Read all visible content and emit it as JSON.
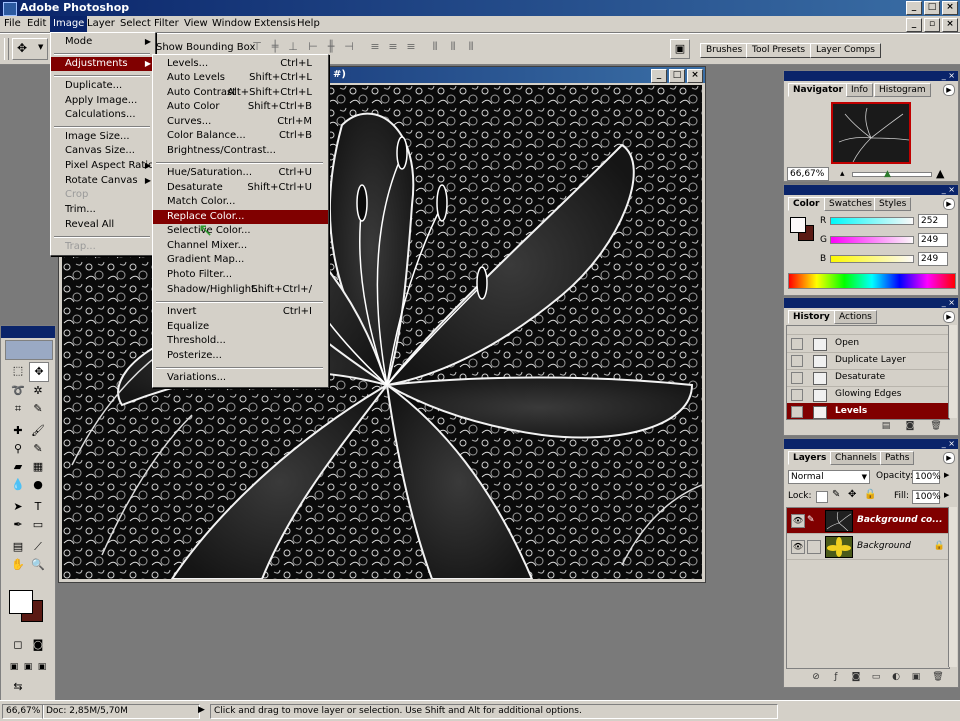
{
  "app": {
    "title": "Adobe Photoshop",
    "window_buttons": [
      "_",
      "□",
      "×"
    ]
  },
  "menubar": [
    "File",
    "Edit",
    "Image",
    "Layer",
    "Select",
    "Filter",
    "View",
    "Window",
    "Extensis",
    "Help"
  ],
  "optionsbar": {
    "show_bounding_box": "Show Bounding Box"
  },
  "palette_well": {
    "brushes": "Brushes",
    "tool_presets": "Tool Presets",
    "layer_comps": "Layer Comps"
  },
  "document": {
    "title_fragment": "#)"
  },
  "image_menu": {
    "items": [
      {
        "label": "Mode",
        "submenu": true
      },
      {
        "label": "Adjustments",
        "submenu": true,
        "highlighted": true
      },
      {
        "label": "Duplicate..."
      },
      {
        "label": "Apply Image..."
      },
      {
        "label": "Calculations..."
      },
      {
        "label": "Image Size..."
      },
      {
        "label": "Canvas Size..."
      },
      {
        "label": "Pixel Aspect Ratio",
        "submenu": true
      },
      {
        "label": "Rotate Canvas",
        "submenu": true
      },
      {
        "label": "Crop",
        "disabled": true
      },
      {
        "label": "Trim..."
      },
      {
        "label": "Reveal All"
      },
      {
        "label": "Trap...",
        "disabled": true
      }
    ]
  },
  "adjustments_menu": {
    "items": [
      {
        "label": "Levels...",
        "shortcut": "Ctrl+L"
      },
      {
        "label": "Auto Levels",
        "shortcut": "Shift+Ctrl+L"
      },
      {
        "label": "Auto Contrast",
        "shortcut": "Alt+Shift+Ctrl+L"
      },
      {
        "label": "Auto Color",
        "shortcut": "Shift+Ctrl+B"
      },
      {
        "label": "Curves...",
        "shortcut": "Ctrl+M"
      },
      {
        "label": "Color Balance...",
        "shortcut": "Ctrl+B"
      },
      {
        "label": "Brightness/Contrast...",
        "shortcut": ""
      },
      {
        "label": "Hue/Saturation...",
        "shortcut": "Ctrl+U"
      },
      {
        "label": "Desaturate",
        "shortcut": "Shift+Ctrl+U"
      },
      {
        "label": "Match Color...",
        "shortcut": ""
      },
      {
        "label": "Replace Color...",
        "shortcut": "",
        "highlighted": true
      },
      {
        "label": "Selective Color...",
        "shortcut": ""
      },
      {
        "label": "Channel Mixer...",
        "shortcut": ""
      },
      {
        "label": "Gradient Map...",
        "shortcut": ""
      },
      {
        "label": "Photo Filter...",
        "shortcut": ""
      },
      {
        "label": "Shadow/Highlight...",
        "shortcut": "Shift+Ctrl+/"
      },
      {
        "label": "Invert",
        "shortcut": "Ctrl+I"
      },
      {
        "label": "Equalize",
        "shortcut": ""
      },
      {
        "label": "Threshold...",
        "shortcut": ""
      },
      {
        "label": "Posterize...",
        "shortcut": ""
      },
      {
        "label": "Variations...",
        "shortcut": ""
      }
    ]
  },
  "navigator": {
    "tabs": [
      "Navigator",
      "Info",
      "Histogram"
    ],
    "zoom": "66,67%"
  },
  "color": {
    "tabs": [
      "Color",
      "Swatches",
      "Styles"
    ],
    "r_label": "R",
    "g_label": "G",
    "b_label": "B",
    "r": "252",
    "g": "249",
    "b": "249"
  },
  "history": {
    "tabs": [
      "History",
      "Actions"
    ],
    "steps": [
      "Open",
      "Duplicate Layer",
      "Desaturate",
      "Glowing Edges",
      "Levels"
    ],
    "selected": "Levels"
  },
  "layers": {
    "tabs": [
      "Layers",
      "Channels",
      "Paths"
    ],
    "blend_mode": "Normal",
    "opacity_label": "Opacity:",
    "opacity": "100%",
    "lock_label": "Lock:",
    "fill_label": "Fill:",
    "fill": "100%",
    "items": [
      {
        "name": "Background co...",
        "selected": true
      },
      {
        "name": "Background",
        "selected": false
      }
    ]
  },
  "status": {
    "zoom": "66,67%",
    "doc": "Doc: 2,85M/5,70M",
    "hint": "Click and drag to move layer or selection.  Use Shift and Alt for additional options."
  },
  "colors": {
    "accent_highlight": "#800000",
    "titlebar": "#0a246a",
    "panel": "#d4d0c8"
  }
}
